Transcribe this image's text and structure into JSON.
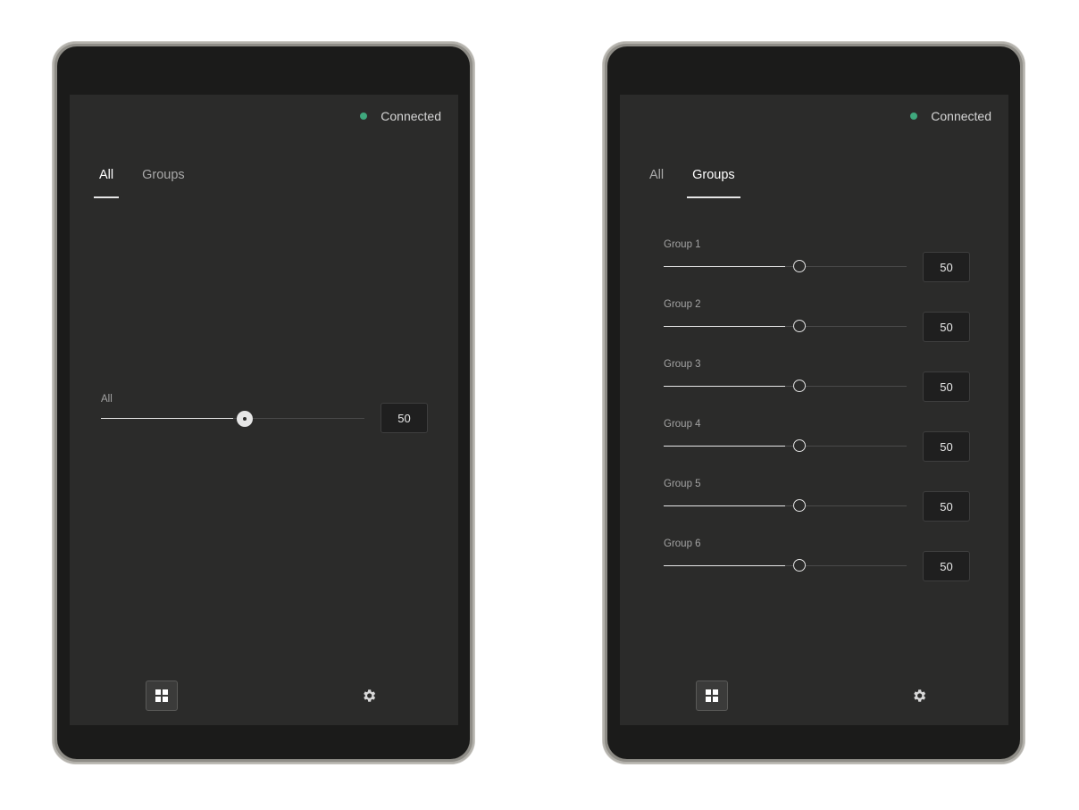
{
  "status": {
    "label": "Connected",
    "color": "#3fa87d"
  },
  "tabs": {
    "all": "All",
    "groups": "Groups"
  },
  "left": {
    "active_tab": "All",
    "master": {
      "label": "All",
      "value": "50",
      "level": 0.5
    }
  },
  "right": {
    "active_tab": "Groups",
    "groups": [
      {
        "label": "Group 1",
        "value": "50",
        "level": 0.5
      },
      {
        "label": "Group 2",
        "value": "50",
        "level": 0.5
      },
      {
        "label": "Group 3",
        "value": "50",
        "level": 0.5
      },
      {
        "label": "Group 4",
        "value": "50",
        "level": 0.5
      },
      {
        "label": "Group 5",
        "value": "50",
        "level": 0.5
      },
      {
        "label": "Group 6",
        "value": "50",
        "level": 0.5
      }
    ]
  },
  "bottom_bar": {
    "dashboard_icon": "grid-icon",
    "settings_icon": "gear-icon"
  }
}
